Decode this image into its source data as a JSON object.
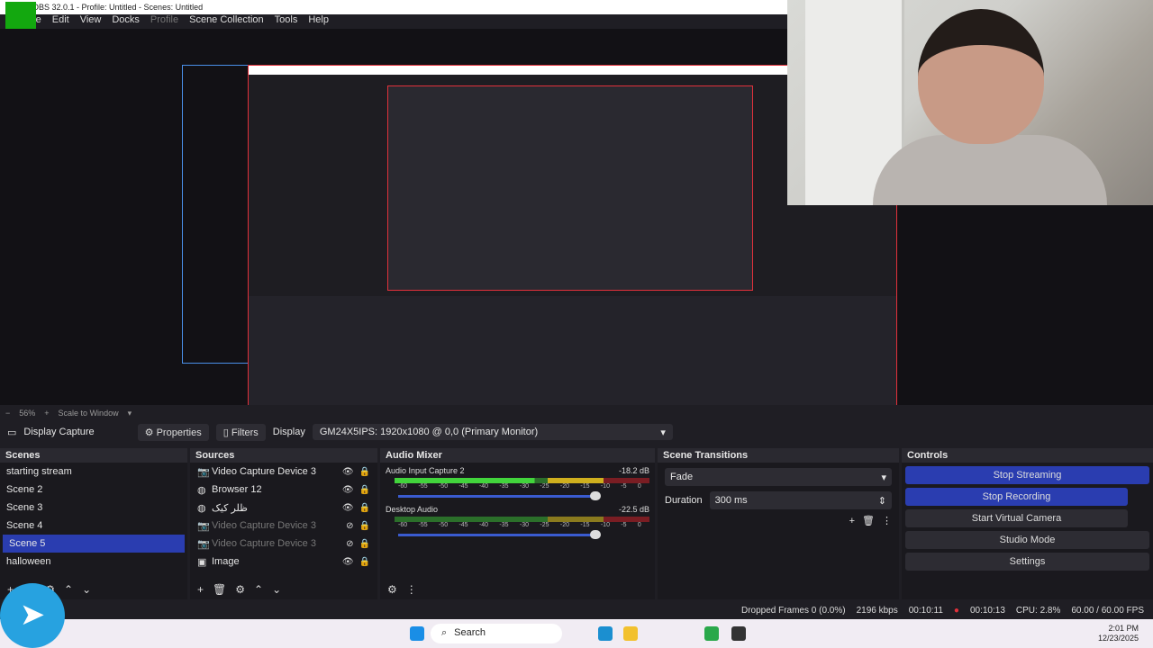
{
  "window": {
    "title": "OBS 32.0.1 - Profile: Untitled - Scenes: Untitled"
  },
  "menu": [
    "File",
    "Edit",
    "View",
    "Docks",
    "Profile",
    "Scene Collection",
    "Tools",
    "Help"
  ],
  "preview": {
    "zoom": "56%",
    "scale_mode": "Scale to Window"
  },
  "source_bar": {
    "source_name": "Display Capture",
    "properties": "Properties",
    "filters": "Filters",
    "display_label": "Display",
    "display_value": "GM24X5IPS: 1920x1080 @ 0,0 (Primary Monitor)"
  },
  "scenes": {
    "title": "Scenes",
    "items": [
      "starting stream",
      "Scene 2",
      "Scene 3",
      "Scene 4",
      "Scene 5",
      "halloween"
    ],
    "selected_index": 4
  },
  "sources": {
    "title": "Sources",
    "items": [
      {
        "name": "Video Capture Device 3",
        "icon": "camera-icon",
        "visible": true
      },
      {
        "name": "Browser 12",
        "icon": "globe-icon",
        "visible": true
      },
      {
        "name": "ظلر کیک",
        "icon": "globe-icon",
        "visible": true
      },
      {
        "name": "Video Capture Device 3",
        "icon": "camera-icon",
        "visible": false
      },
      {
        "name": "Video Capture Device 3",
        "icon": "camera-icon",
        "visible": false
      },
      {
        "name": "Image",
        "icon": "image-icon",
        "visible": true
      }
    ]
  },
  "mixer": {
    "title": "Audio Mixer",
    "channels": [
      {
        "name": "Audio Input Capture 2",
        "db": "-18.2 dB",
        "level": 0.55
      },
      {
        "name": "Desktop Audio",
        "db": "-22.5 dB",
        "level": 0.0
      }
    ],
    "ticks": [
      "-60",
      "-55",
      "-50",
      "-45",
      "-40",
      "-35",
      "-30",
      "-25",
      "-20",
      "-15",
      "-10",
      "-5",
      "0"
    ]
  },
  "transitions": {
    "title": "Scene Transitions",
    "selected": "Fade",
    "duration_label": "Duration",
    "duration_value": "300 ms"
  },
  "controls": {
    "title": "Controls",
    "buttons": [
      "Stop Streaming",
      "Stop Recording",
      "Start Virtual Camera",
      "Studio Mode",
      "Settings"
    ]
  },
  "status": {
    "dropped": "Dropped Frames 0 (0.0%)",
    "bitrate": "2196 kbps",
    "stream_time": "00:10:11",
    "rec_time": "00:10:13",
    "cpu": "CPU: 2.8%",
    "fps": "60.00 / 60.00 FPS"
  },
  "taskbar": {
    "search": "Search",
    "time": "2:01 PM",
    "date": "12/23/2025"
  },
  "colors": {
    "accent": "#2a3db0",
    "recording": "#e2313b",
    "selection": "#4a8fe8"
  }
}
